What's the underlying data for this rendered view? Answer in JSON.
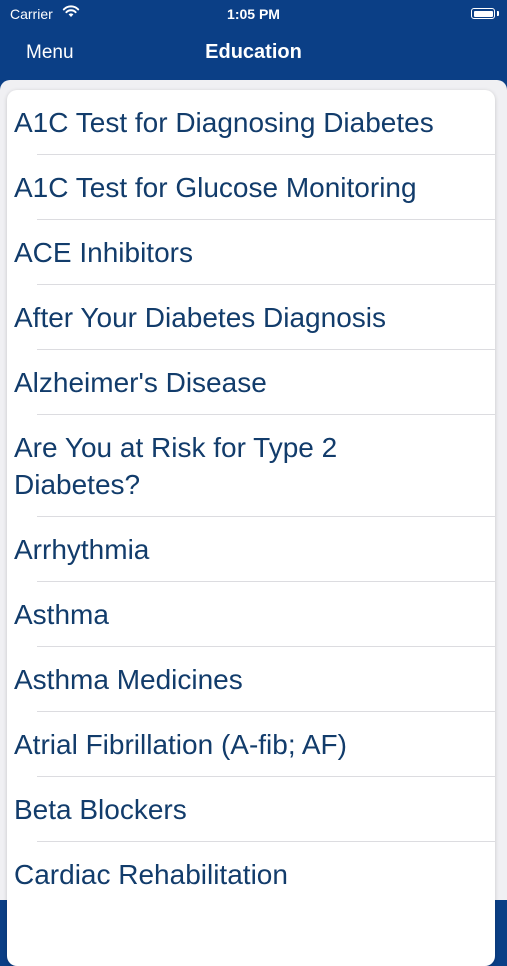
{
  "status_bar": {
    "carrier": "Carrier",
    "time": "1:05 PM"
  },
  "nav": {
    "menu_label": "Menu",
    "title": "Education"
  },
  "topics": [
    "A1C Test for Diagnosing Diabetes",
    "A1C Test for Glucose Monitoring",
    "ACE Inhibitors",
    "After Your Diabetes Diagnosis",
    "Alzheimer's Disease",
    "Are You at Risk for Type 2 Diabetes?",
    "Arrhythmia",
    "Asthma",
    "Asthma Medicines",
    "Atrial Fibrillation (A-fib; AF)",
    "Beta Blockers",
    "Cardiac Rehabilitation"
  ],
  "colors": {
    "nav_background": "#0b3f86",
    "item_text": "#123c6b"
  }
}
